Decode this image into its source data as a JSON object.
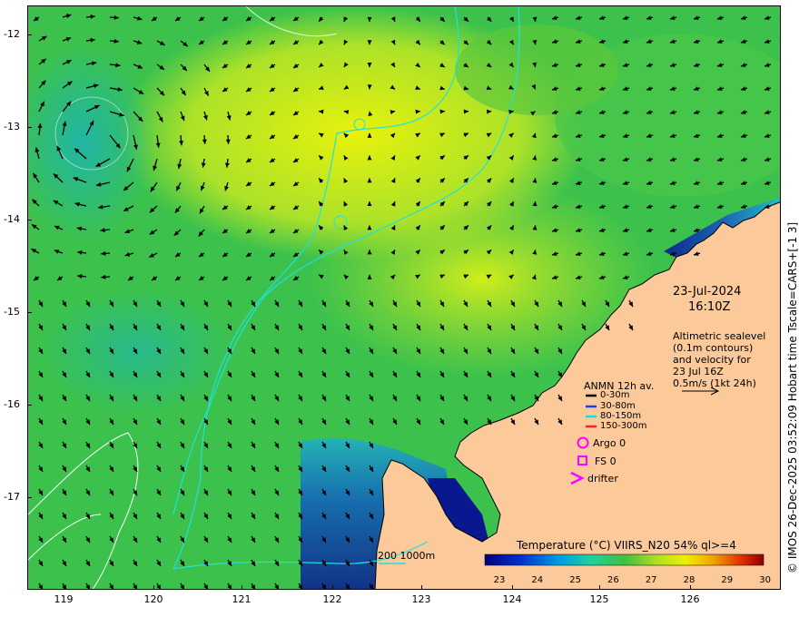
{
  "map": {
    "date": "23-Jul-2024",
    "time": "16:10Z",
    "altimetry_note": [
      "Altimetric sealevel",
      "(0.1m contours)",
      "and velocity for",
      "23 Jul 16Z"
    ],
    "scale_text": "0.5m/s (1kt 24h)",
    "depth_legend": "200  1000m",
    "lat_labels": [
      "-12",
      "-13",
      "-14",
      "-15",
      "-16",
      "-17"
    ],
    "lon_labels": [
      "119",
      "120",
      "121",
      "122",
      "123",
      "124",
      "125",
      "126"
    ],
    "credit": "© IMOS 26-Dec-2025 03:52:09 Hobart time Tscale=CARS+[-1 3]"
  },
  "anmn_legend": {
    "title": "ANMN 12h av.",
    "items": [
      {
        "label": "0-30m",
        "color": "#000000"
      },
      {
        "label": "30-80m",
        "color": "#1a3cff"
      },
      {
        "label": "80-150m",
        "color": "#00e6e6"
      },
      {
        "label": "150-300m",
        "color": "#ff2020"
      }
    ]
  },
  "symbols": [
    {
      "label": "Argo 0",
      "symbol": "circle",
      "color": "#ff00ff"
    },
    {
      "label": "FS 0",
      "symbol": "square",
      "color": "#ff00ff"
    },
    {
      "label": "drifter",
      "symbol": "chevron",
      "color": "#ff00ff"
    }
  ],
  "colorbar": {
    "title": "Temperature (°C) VIIRS_N20 54% ql>=4",
    "ticks": [
      "23",
      "24",
      "25",
      "26",
      "27",
      "28",
      "29",
      "30"
    ]
  },
  "colors": {
    "land": "#fbc99a",
    "ocean_warm": "#d9f21a",
    "ocean_mid": "#3cc24c",
    "ocean_cool": "#1aa8c8",
    "ocean_cold": "#0a1a9a",
    "isobath": "#20e0e0"
  }
}
